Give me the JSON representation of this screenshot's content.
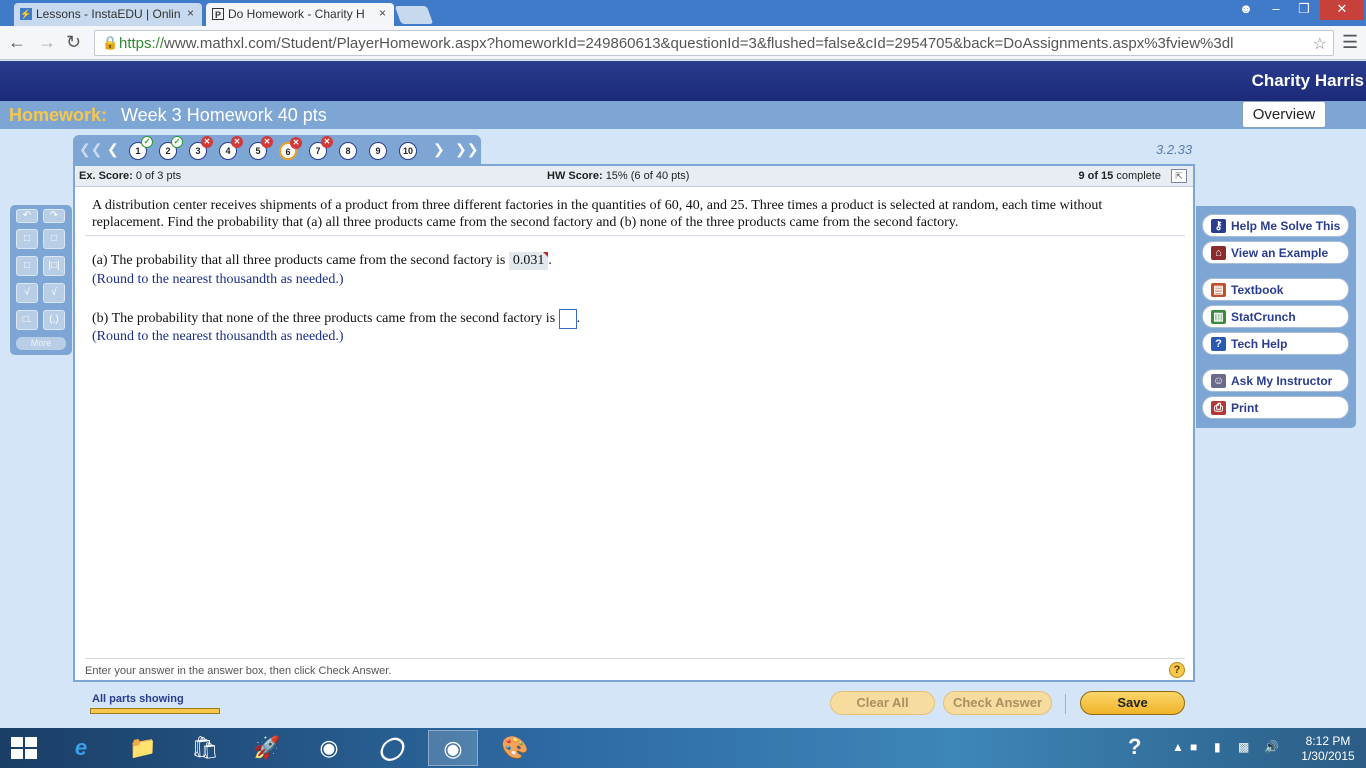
{
  "browser": {
    "tabs": [
      {
        "title": "Lessons - InstaEDU | Onlin",
        "favicon": "lightning-icon",
        "active": false
      },
      {
        "title": "Do Homework - Charity H",
        "favicon": "p-icon",
        "active": true
      }
    ],
    "close_glyph": "×",
    "url_scheme": "https://",
    "url_rest": "www.mathxl.com/Student/PlayerHomework.aspx?homeworkId=249860613&questionId=3&flushed=false&cId=2954705&back=DoAssignments.aspx%3fview%3dl"
  },
  "header": {
    "user_name": "Charity Harris",
    "homework_label": "Homework:",
    "homework_title": "Week 3 Homework 40 pts",
    "overview_label": "Overview"
  },
  "nav": {
    "questions": [
      {
        "num": "1",
        "status": "correct"
      },
      {
        "num": "2",
        "status": "correct"
      },
      {
        "num": "3",
        "status": "wrong"
      },
      {
        "num": "4",
        "status": "wrong"
      },
      {
        "num": "5",
        "status": "wrong"
      },
      {
        "num": "6",
        "status": "wrong"
      },
      {
        "num": "7",
        "status": "wrong"
      },
      {
        "num": "8",
        "status": "none"
      },
      {
        "num": "9",
        "status": "none"
      },
      {
        "num": "10",
        "status": "none"
      }
    ],
    "section": "3.2.33"
  },
  "scores": {
    "ex_label": "Ex. Score:",
    "ex_value": "0 of 3 pts",
    "hw_label": "HW Score:",
    "hw_value": "15% (6 of 40 pts)",
    "complete_count": "9 of 15",
    "complete_label": "complete"
  },
  "question": {
    "text": "A distribution center receives shipments of a product from three different factories in the quantities of 60, 40, and 25. Three times a product is selected at random, each time without replacement. Find the probability that (a) all three products came from the second factory and (b) none of the three products came from the second factory.",
    "part_a": "(a) The probability that all three products came from the second factory is",
    "part_a_answer": "0.031",
    "part_b": "(b) The probability that none of the three products came from the second factory is",
    "hint": "(Round to the nearest thousandth as needed.)",
    "period": "."
  },
  "footer": {
    "instruction": "Enter your answer in the answer box, then click Check Answer.",
    "help": "?",
    "parts_label": "All parts showing"
  },
  "palette": {
    "more_label": "More"
  },
  "help_menu": [
    {
      "label": "Help Me Solve This",
      "icon": "key-icon",
      "color": "#2a3c8f"
    },
    {
      "label": "View an Example",
      "icon": "house-icon",
      "color": "#8a2a2a"
    },
    {
      "label": "Textbook",
      "icon": "book-icon",
      "color": "#c0502a"
    },
    {
      "label": "StatCrunch",
      "icon": "chart-icon",
      "color": "#3a8a3a"
    },
    {
      "label": "Tech Help",
      "icon": "question-icon",
      "color": "#2a5ab0"
    },
    {
      "label": "Ask My Instructor",
      "icon": "person-icon",
      "color": "#6a6a8a"
    },
    {
      "label": "Print",
      "icon": "printer-icon",
      "color": "#b03a3a"
    }
  ],
  "buttons": {
    "clear_all": "Clear All",
    "check_answer": "Check Answer",
    "save": "Save"
  },
  "taskbar": {
    "time": "8:12 PM",
    "date": "1/30/2015"
  }
}
